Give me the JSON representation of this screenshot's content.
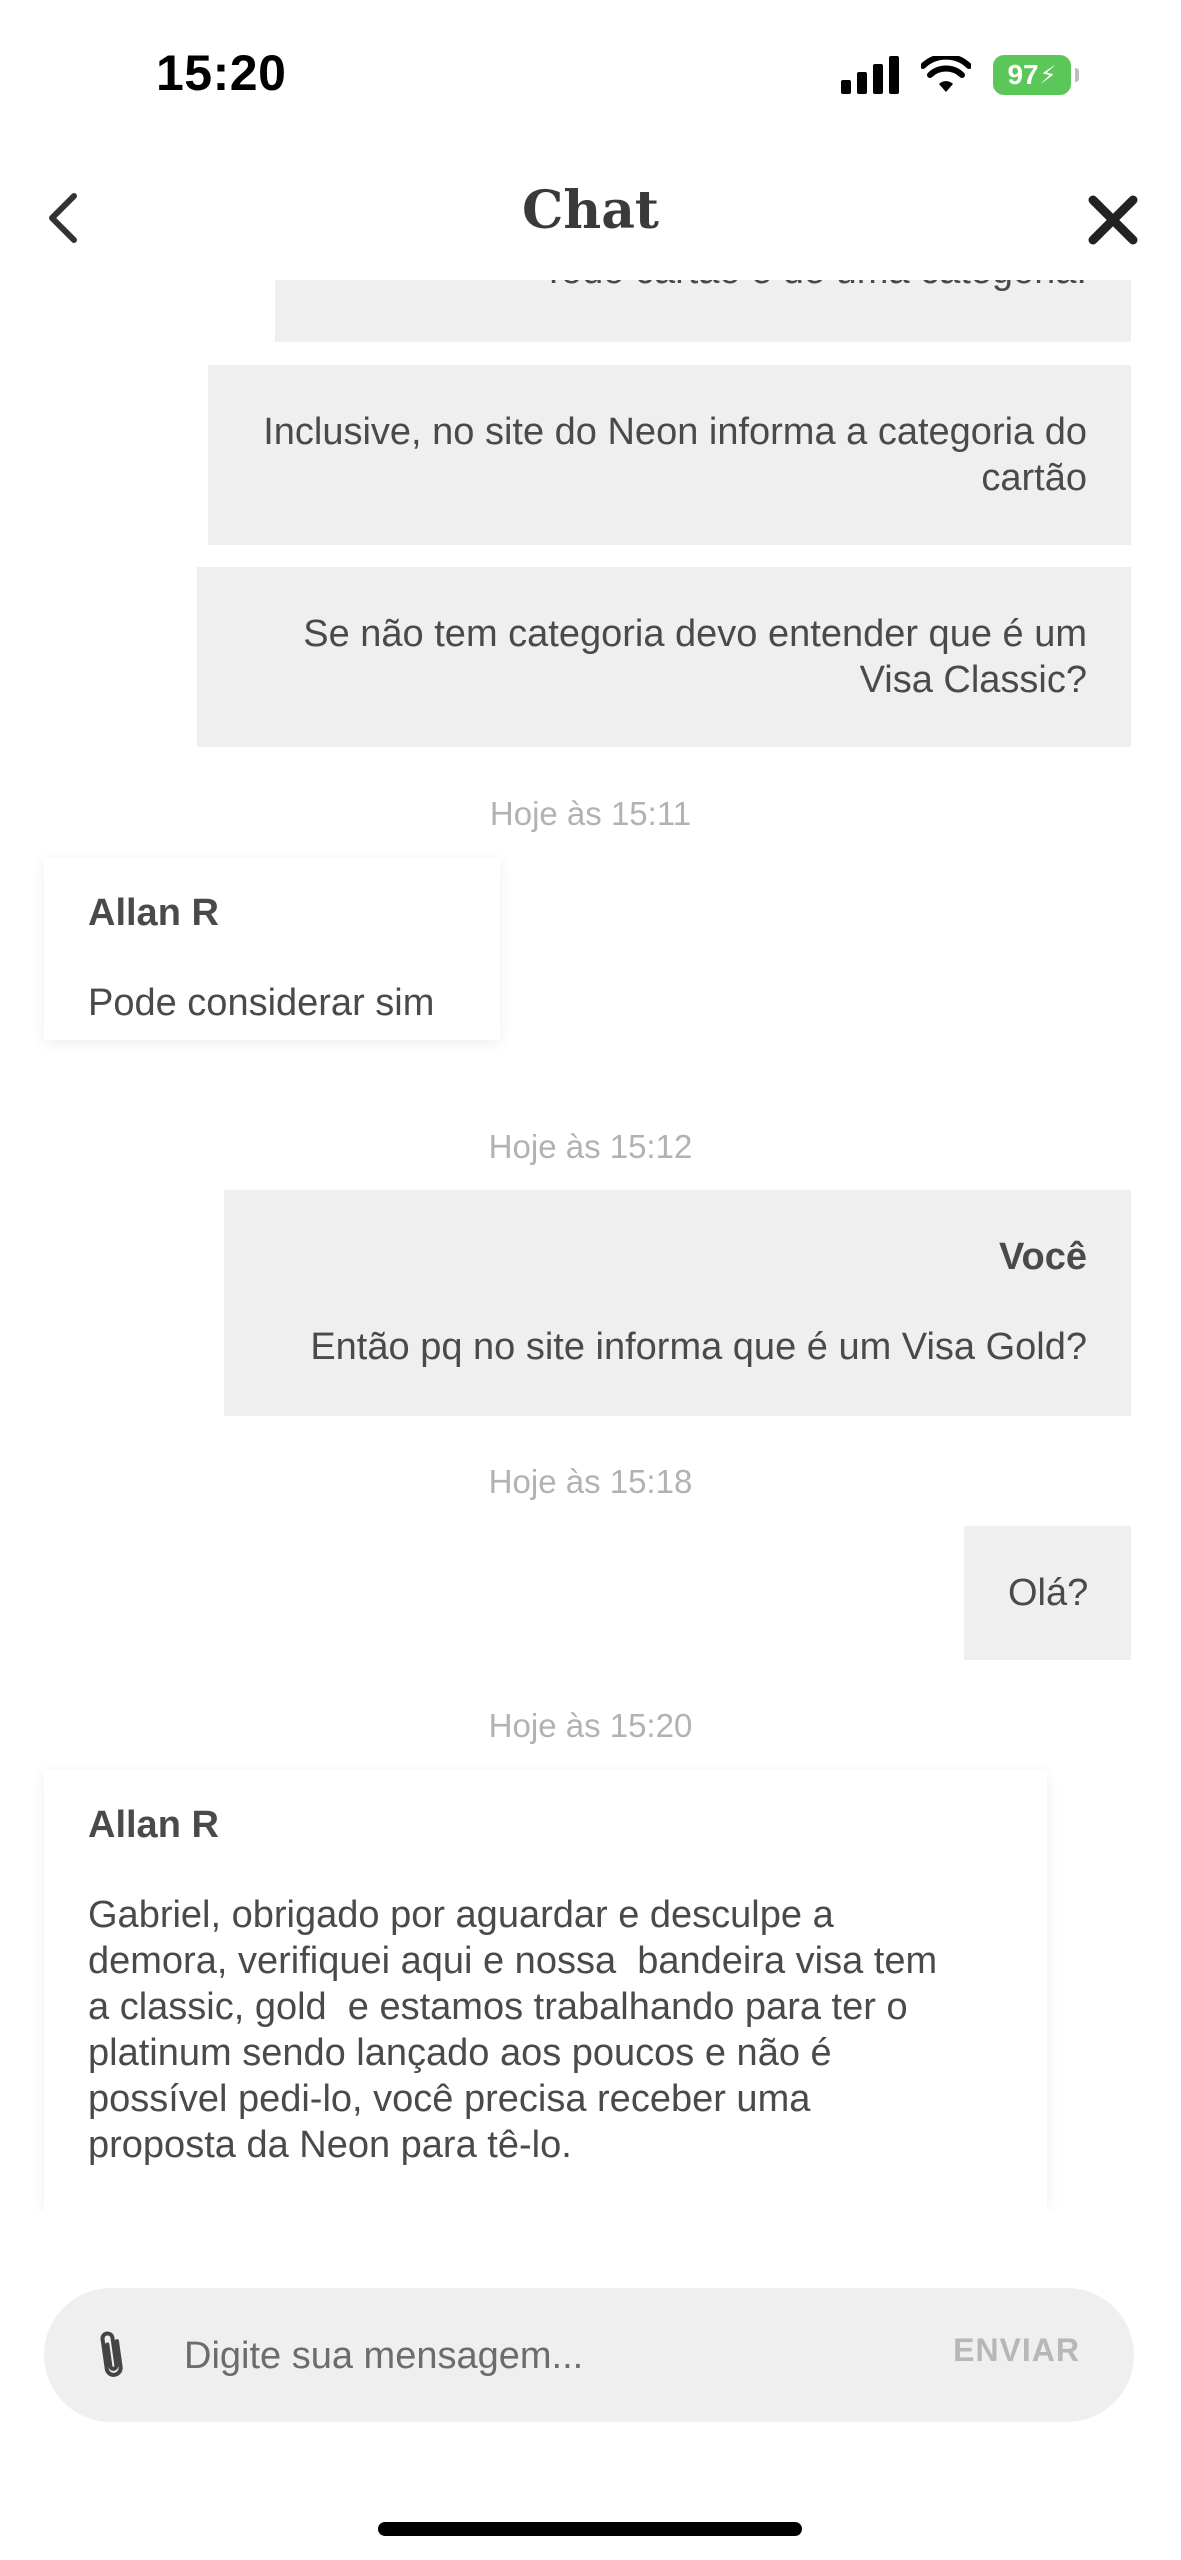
{
  "status_bar": {
    "time": "15:20",
    "battery": "97"
  },
  "header": {
    "title": "Chat"
  },
  "messages": [
    {
      "text": "Todo cartão é de uma categoria."
    },
    {
      "text": "Inclusive, no site do Neon informa a categoria do cartão"
    },
    {
      "text": "Se não tem categoria devo entender que é um Visa Classic?"
    }
  ],
  "timestamps": [
    "Hoje às 15:11",
    "Hoje às 15:12",
    "Hoje às 15:18",
    "Hoje às 15:20"
  ],
  "agent_reply_1": {
    "sender": "Allan R",
    "text": "Pode considerar sim"
  },
  "user_reply_1": {
    "sender": "Você",
    "text": "Então pq no site informa que é um Visa Gold?"
  },
  "user_reply_2": {
    "text": "Olá?"
  },
  "agent_reply_2": {
    "sender": "Allan R",
    "lines": [
      "Gabriel, obrigado por aguardar e desculpe a",
      "demora, verifiquei aqui e nossa  bandeira visa tem",
      "a classic, gold  e estamos trabalhando para ter o",
      "platinum sendo lançado aos poucos e não é",
      "possível pedi-lo, você precisa receber uma",
      "proposta da Neon para tê-lo."
    ]
  },
  "composer": {
    "placeholder": "Digite sua mensagem...",
    "send_label": "ENVIAR"
  },
  "icons": {
    "back": "chevron-left-icon",
    "close": "close-icon",
    "attach": "paperclip-icon"
  }
}
